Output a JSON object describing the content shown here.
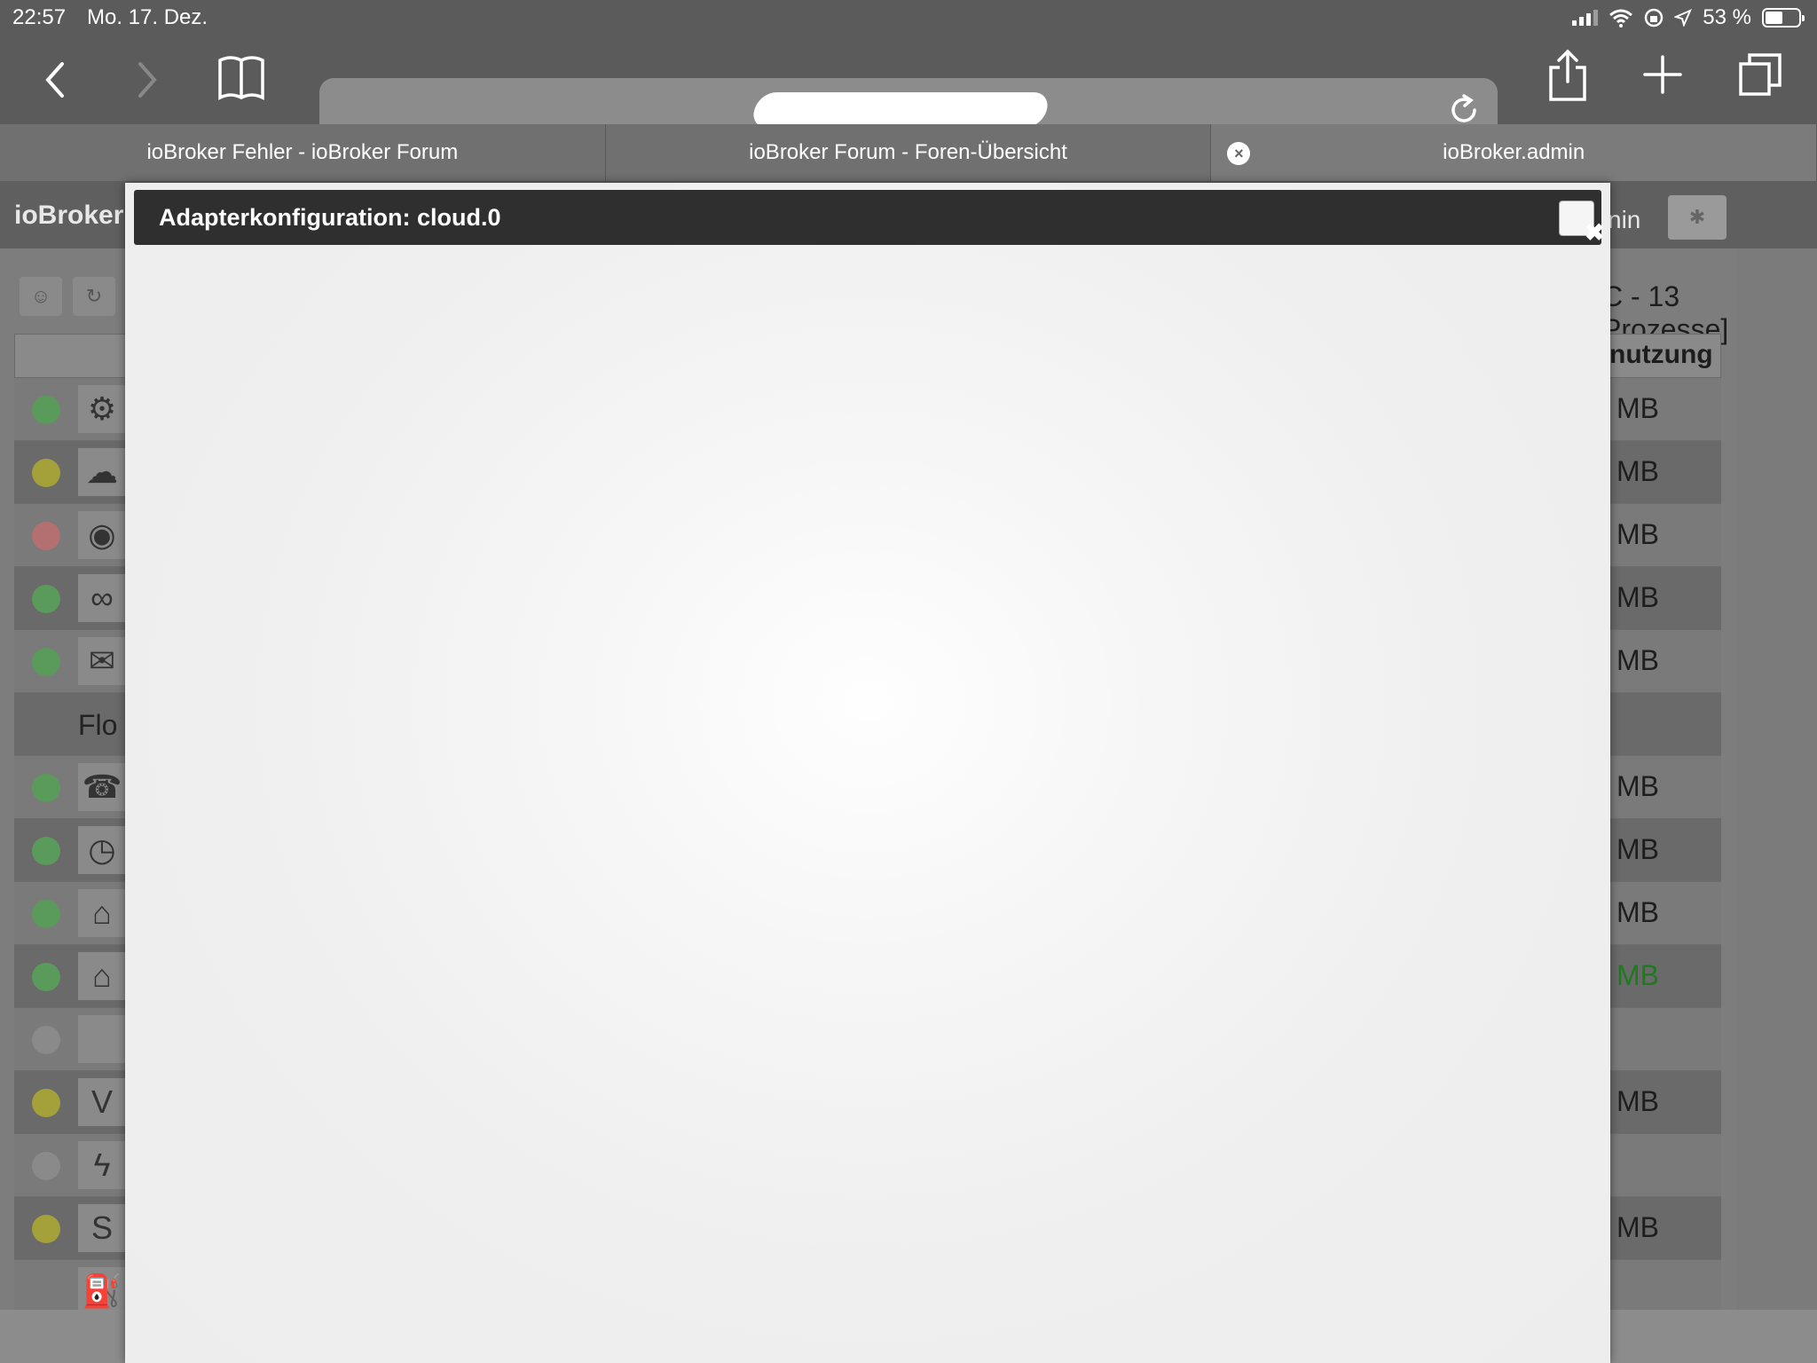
{
  "status_bar": {
    "time": "22:57",
    "date": "Mo. 17. Dez.",
    "battery_percent": "53 %",
    "battery_level": 0.53
  },
  "browser": {
    "tabs": [
      {
        "label": "ioBroker Fehler - ioBroker Forum",
        "active": false
      },
      {
        "label": "ioBroker Forum - Foren-Übersicht",
        "active": false
      },
      {
        "label": "ioBroker.admin",
        "active": true
      }
    ]
  },
  "background_page": {
    "title": "ioBroker",
    "user_label": "nin",
    "process_info": "C - 13 Prozesse]",
    "memory_column_header": "nutzung",
    "group_label": "Flo",
    "memory_unit": "MB",
    "rows": [
      {
        "status_color": "#5a9a5a",
        "icon": "gear-icon",
        "mb": "MB"
      },
      {
        "status_color": "#a5a13a",
        "icon": "cloud-icon",
        "mb": "MB"
      },
      {
        "status_color": "#b47070",
        "icon": "busware-icon",
        "mb": "MB"
      },
      {
        "status_color": "#5a9a5a",
        "icon": "binoculars-icon",
        "mb": "MB"
      },
      {
        "status_color": "#5a9a5a",
        "icon": "mail-icon",
        "mb": "MB"
      },
      {
        "status_color": "",
        "icon": "",
        "mb": "",
        "group": true
      },
      {
        "status_color": "#5a9a5a",
        "icon": "phone-icon",
        "mb": "MB"
      },
      {
        "status_color": "#5a9a5a",
        "icon": "clock-icon",
        "mb": "MB"
      },
      {
        "status_color": "#5a9a5a",
        "icon": "homematic-icon",
        "mb": "MB"
      },
      {
        "status_color": "#5a9a5a",
        "icon": "homematic-icon",
        "mb": "MB",
        "green": true
      },
      {
        "status_color": "#8a8a8a",
        "icon": "",
        "mb": ""
      },
      {
        "status_color": "#a5a13a",
        "icon": "viera-icon",
        "mb": "MB"
      },
      {
        "status_color": "#8a8a8a",
        "icon": "flash-icon",
        "mb": ""
      },
      {
        "status_color": "#a5a13a",
        "icon": "sonoff-icon",
        "mb": "MB"
      },
      {
        "status_color": "",
        "icon": "fuel-icon",
        "mb": ""
      }
    ]
  },
  "modal": {
    "title": "Adapterkonfiguration: cloud.0"
  }
}
